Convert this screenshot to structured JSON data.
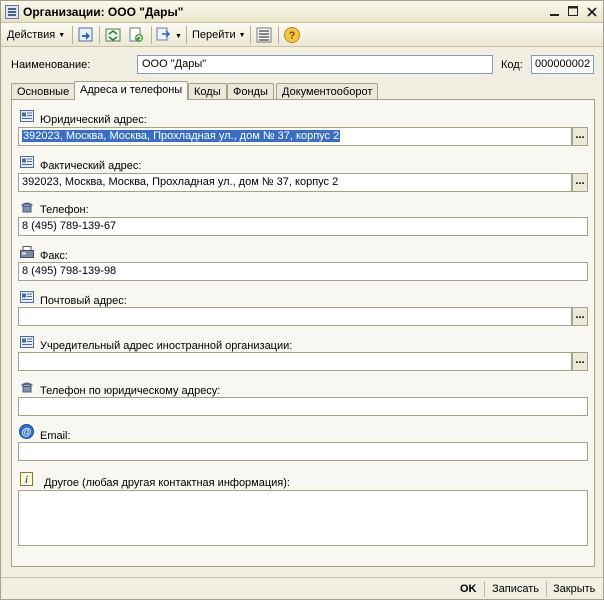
{
  "window": {
    "title": "Организации: ООО \"Дары\""
  },
  "toolbar": {
    "actions_label": "Действия",
    "goto_label": "Перейти"
  },
  "header": {
    "name_label": "Наименование:",
    "name_value": "ООО \"Дары\"",
    "code_label": "Код:",
    "code_value": "000000002"
  },
  "tabs": [
    {
      "label": "Основные"
    },
    {
      "label": "Адреса и телефоны"
    },
    {
      "label": "Коды"
    },
    {
      "label": "Фонды"
    },
    {
      "label": "Документооборот"
    }
  ],
  "contacts": {
    "legal_address_label": "Юридический адрес:",
    "legal_address_value": "392023, Москва, Москва, Прохладная ул., дом № 37, корпус 2",
    "actual_address_label": "Фактический адрес:",
    "actual_address_value": "392023, Москва, Москва, Прохладная ул., дом № 37, корпус 2",
    "phone_label": "Телефон:",
    "phone_value": "8 (495) 789-139-67",
    "fax_label": "Факс:",
    "fax_value": "8 (495) 798-139-98",
    "postal_label": "Почтовый адрес:",
    "postal_value": "",
    "foreign_label": "Учредительный адрес иностранной организации:",
    "foreign_value": "",
    "legal_phone_label": "Телефон по юридическому адресу:",
    "legal_phone_value": "",
    "email_label": "Email:",
    "email_value": "",
    "other_label": "Другое (любая другая контактная информация):",
    "other_value": ""
  },
  "footer": {
    "ok_label": "OK",
    "save_label": "Записать",
    "close_label": "Закрыть"
  },
  "dots": "..."
}
